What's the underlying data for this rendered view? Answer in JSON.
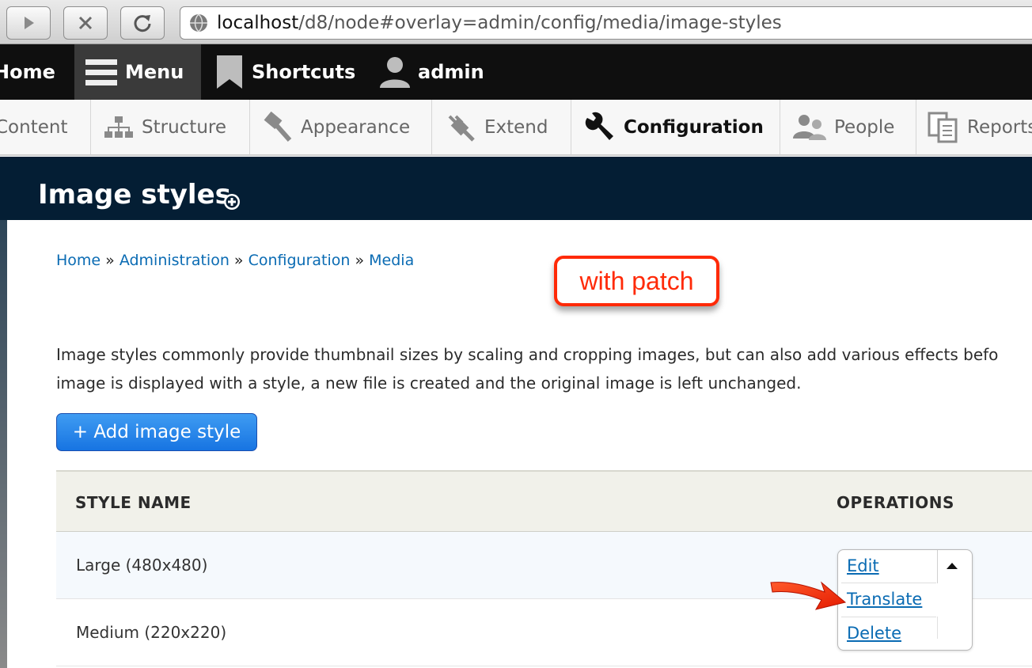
{
  "browser": {
    "url_host": "localhost",
    "url_path": "/d8/node#overlay=admin/config/media/image-styles"
  },
  "toolbar": {
    "home": "Home",
    "menu": "Menu",
    "shortcuts": "Shortcuts",
    "user": "admin"
  },
  "tray": {
    "items": [
      "Content",
      "Structure",
      "Appearance",
      "Extend",
      "Configuration",
      "People",
      "Reports"
    ],
    "active": "Configuration"
  },
  "page": {
    "title": "Image styles"
  },
  "breadcrumb": {
    "items": [
      "Home",
      "Administration",
      "Configuration",
      "Media"
    ],
    "separator": "»"
  },
  "annotation": {
    "note": "with patch"
  },
  "description": {
    "line1": "Image styles commonly provide thumbnail sizes by scaling and cropping images, but can also add various effects befo",
    "line2": "image is displayed with a style, a new file is created and the original image is left unchanged."
  },
  "actions": {
    "add_label": "+ Add image style"
  },
  "table": {
    "headers": [
      "STYLE NAME",
      "OPERATIONS"
    ],
    "rows": [
      {
        "name": "Large (480x480)"
      },
      {
        "name": "Medium (220x220)"
      }
    ]
  },
  "operations": {
    "edit": "Edit",
    "translate": "Translate",
    "delete": "Delete"
  },
  "colors": {
    "link": "#0a6bb3",
    "overlay_header": "#041e34",
    "annotation": "#ff2a08",
    "button": "#1774e2"
  }
}
